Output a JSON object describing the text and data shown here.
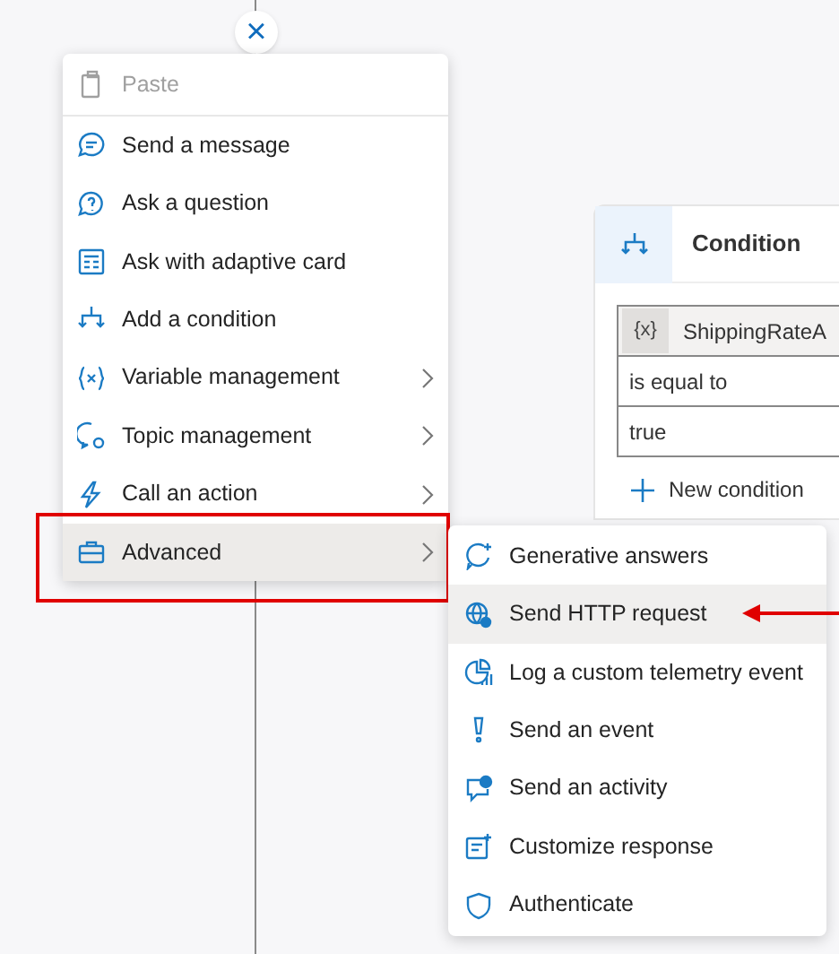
{
  "close_button": {
    "label": "×"
  },
  "menu": {
    "items": [
      {
        "label": "Paste",
        "disabled": true,
        "has_submenu": false,
        "selected": false
      },
      {
        "label": "Send a message",
        "disabled": false,
        "has_submenu": false,
        "selected": false
      },
      {
        "label": "Ask a question",
        "disabled": false,
        "has_submenu": false,
        "selected": false
      },
      {
        "label": "Ask with adaptive card",
        "disabled": false,
        "has_submenu": false,
        "selected": false
      },
      {
        "label": "Add a condition",
        "disabled": false,
        "has_submenu": false,
        "selected": false
      },
      {
        "label": "Variable management",
        "disabled": false,
        "has_submenu": true,
        "selected": false
      },
      {
        "label": "Topic management",
        "disabled": false,
        "has_submenu": true,
        "selected": false
      },
      {
        "label": "Call an action",
        "disabled": false,
        "has_submenu": true,
        "selected": false
      },
      {
        "label": "Advanced",
        "disabled": false,
        "has_submenu": true,
        "selected": true
      }
    ]
  },
  "submenu": {
    "items": [
      {
        "label": "Generative answers",
        "selected": false
      },
      {
        "label": "Send HTTP request",
        "selected": true
      },
      {
        "label": "Log a custom telemetry event",
        "selected": false
      },
      {
        "label": "Send an event",
        "selected": false
      },
      {
        "label": "Send an activity",
        "selected": false
      },
      {
        "label": "Customize response",
        "selected": false
      },
      {
        "label": "Authenticate",
        "selected": false
      }
    ]
  },
  "condition_card": {
    "title": "Condition",
    "variable_chip": "{x}",
    "variable": "ShippingRateA",
    "operator": "is equal to",
    "value": "true",
    "add_button": "New condition"
  }
}
